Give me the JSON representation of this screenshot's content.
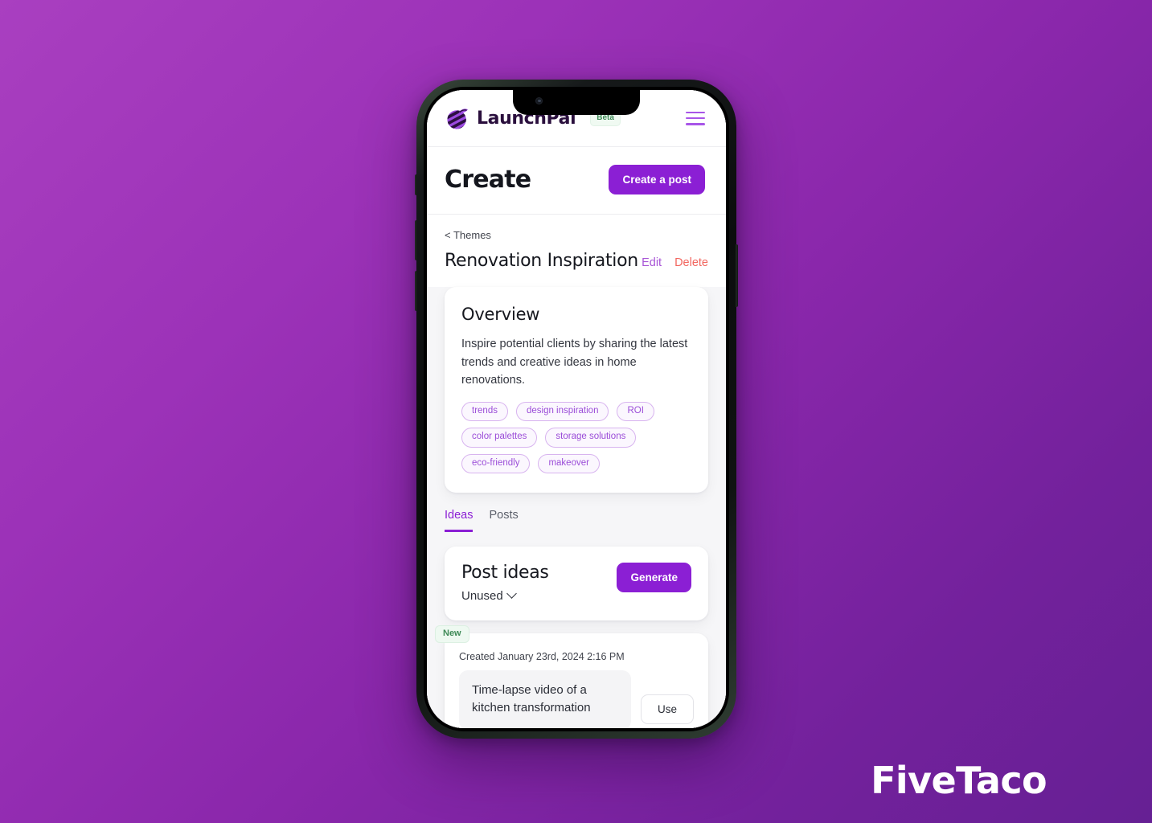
{
  "brand": {
    "name": "LaunchPal",
    "badge": "Beta",
    "logo_icon": "striped-sphere-logo",
    "menu_icon": "hamburger-menu-icon"
  },
  "header": {
    "title": "Create",
    "create_post_label": "Create a post"
  },
  "breadcrumb": {
    "label": "< Themes"
  },
  "theme": {
    "name": "Renovation Inspiration",
    "edit_label": "Edit",
    "delete_label": "Delete"
  },
  "overview": {
    "title": "Overview",
    "description": "Inspire potential clients by sharing the latest trends and creative ideas in home renovations.",
    "tags": [
      "trends",
      "design inspiration",
      "ROI",
      "color palettes",
      "storage solutions",
      "eco-friendly",
      "makeover"
    ]
  },
  "tabs": [
    {
      "label": "Ideas",
      "active": true
    },
    {
      "label": "Posts",
      "active": false
    }
  ],
  "ideas_panel": {
    "heading": "Post ideas",
    "filter_value": "Unused",
    "filter_icon": "chevron-down-icon",
    "generate_label": "Generate"
  },
  "idea_item": {
    "badge": "New",
    "created": "Created January 23rd, 2024 2:16 PM",
    "text": "Time-lapse video of a kitchen transformation",
    "use_label": "Use"
  },
  "watermark": {
    "text": "FiveTaco"
  },
  "colors": {
    "background_start": "#a93fc0",
    "background_end": "#662094",
    "accent_purple": "#8b1fd4",
    "link_purple": "#a855d6",
    "delete_red": "#f2665f",
    "badge_green": "#3f8a57",
    "tag_purple": "#9b4dd8"
  }
}
